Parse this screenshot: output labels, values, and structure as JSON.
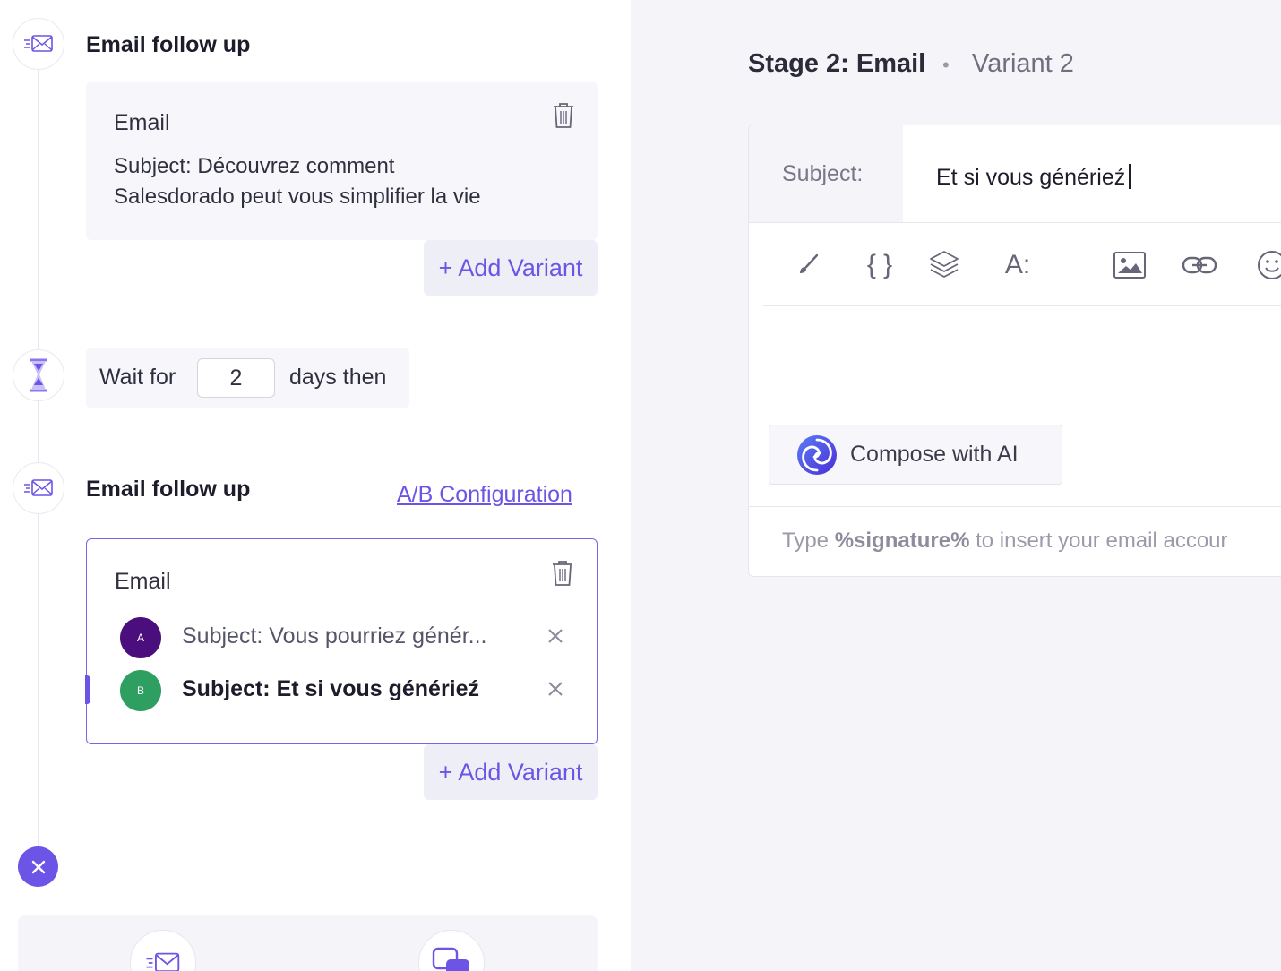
{
  "steps": {
    "first": {
      "title": "Email follow up",
      "card_label": "Email",
      "subject_line1": "Subject: Découvrez comment",
      "subject_line2": "Salesdorado peut vous simplifier la vie",
      "add_variant": "+ Add Variant"
    },
    "wait": {
      "prefix": "Wait for",
      "days_value": "2",
      "suffix": "days then"
    },
    "second": {
      "title": "Email follow up",
      "ab_link": "A/B Configuration",
      "card_label": "Email",
      "variants": [
        {
          "badge": "A",
          "subject": "Subject: Vous pourriez génér...",
          "color": "#4a0f7d"
        },
        {
          "badge": "B",
          "subject": "Subject: Et si vous générieź",
          "color": "#2e9e61"
        }
      ],
      "add_variant": "+ Add Variant"
    }
  },
  "editor": {
    "stage_title": "Stage 2: Email",
    "separator": "•",
    "variant_label": "Variant 2",
    "subject_label": "Subject:",
    "subject_value": "Et si vous générieź",
    "toolbar_icons": [
      "brush-icon",
      "braces-icon",
      "layers-icon",
      "font-icon",
      "image-icon",
      "link-icon",
      "emoji-icon"
    ],
    "toolbar_braces": "{ }",
    "toolbar_font": "A:",
    "compose_label": "Compose with AI",
    "signature_prefix": "Type ",
    "signature_token": "%signature%",
    "signature_suffix": " to insert your email accour"
  },
  "colors": {
    "accent": "#6b54e6",
    "panel_bg": "#f4f4f9"
  }
}
